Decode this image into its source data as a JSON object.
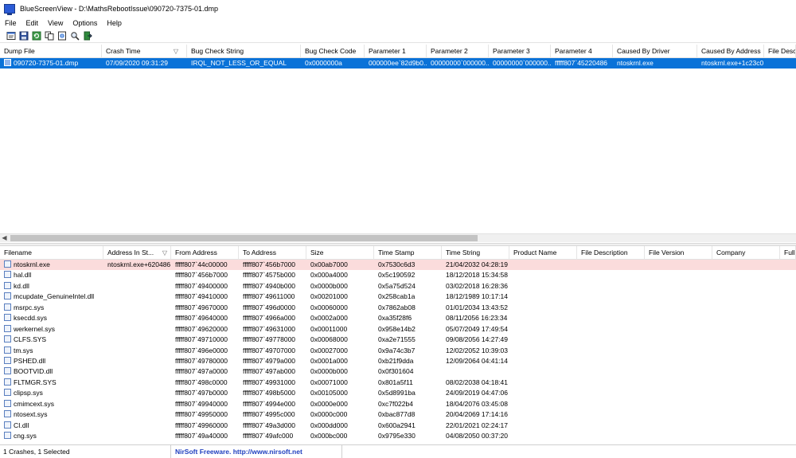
{
  "window": {
    "app_name": "BlueScreenView",
    "title": "BlueScreenView  -  D:\\MathsRebootIssue\\090720-7375-01.dmp"
  },
  "menu": [
    "File",
    "Edit",
    "View",
    "Options",
    "Help"
  ],
  "toolbar": {
    "buttons": [
      "properties-icon",
      "save-icon",
      "refresh-icon",
      "copy-icon",
      "html-report-icon",
      "find-icon",
      "exit-icon"
    ]
  },
  "crash_table": {
    "columns": [
      "Dump File",
      "Crash Time",
      "Bug Check String",
      "Bug Check Code",
      "Parameter 1",
      "Parameter 2",
      "Parameter 3",
      "Parameter 4",
      "Caused By Driver",
      "Caused By Address",
      "File Descr"
    ],
    "sort_indicator": "▽",
    "rows": [
      [
        "090720-7375-01.dmp",
        "07/09/2020 09:31:29",
        "IRQL_NOT_LESS_OR_EQUAL",
        "0x0000000a",
        "000000ee`82d9b0...",
        "00000000`000000...",
        "00000000`000000...",
        "fffff807`45220486",
        "ntoskrnl.exe",
        "ntoskrnl.exe+1c23c0",
        ""
      ]
    ]
  },
  "driver_table": {
    "columns": [
      "Filename",
      "Address In St...",
      "From Address",
      "To Address",
      "Size",
      "Time Stamp",
      "Time String",
      "Product Name",
      "File Description",
      "File Version",
      "Company",
      "Full"
    ],
    "sort_indicator": "▽",
    "rows": [
      [
        "ntoskrnl.exe",
        "ntoskrnl.exe+620486",
        "fffff807`44c00000",
        "fffff807`456b7000",
        "0x00ab7000",
        "0x7530c6d3",
        "21/04/2032 04:28:19",
        "",
        "",
        "",
        "",
        ""
      ],
      [
        "hal.dll",
        "",
        "fffff807`456b7000",
        "fffff807`4575b000",
        "0x000a4000",
        "0x5c190592",
        "18/12/2018 15:34:58",
        "",
        "",
        "",
        "",
        ""
      ],
      [
        "kd.dll",
        "",
        "fffff807`49400000",
        "fffff807`4940b000",
        "0x0000b000",
        "0x5a75d524",
        "03/02/2018 16:28:36",
        "",
        "",
        "",
        "",
        ""
      ],
      [
        "mcupdate_GenuineIntel.dll",
        "",
        "fffff807`49410000",
        "fffff807`49611000",
        "0x00201000",
        "0x258cab1a",
        "18/12/1989 10:17:14",
        "",
        "",
        "",
        "",
        ""
      ],
      [
        "msrpc.sys",
        "",
        "fffff807`49670000",
        "fffff807`496d0000",
        "0x00060000",
        "0x7862ab08",
        "01/01/2034 13:43:52",
        "",
        "",
        "",
        "",
        ""
      ],
      [
        "ksecdd.sys",
        "",
        "fffff807`49640000",
        "fffff807`4966a000",
        "0x0002a000",
        "0xa35f28f6",
        "08/11/2056 16:23:34",
        "",
        "",
        "",
        "",
        ""
      ],
      [
        "werkernel.sys",
        "",
        "fffff807`49620000",
        "fffff807`49631000",
        "0x00011000",
        "0x958e14b2",
        "05/07/2049 17:49:54",
        "",
        "",
        "",
        "",
        ""
      ],
      [
        "CLFS.SYS",
        "",
        "fffff807`49710000",
        "fffff807`49778000",
        "0x00068000",
        "0xa2e71555",
        "09/08/2056 14:27:49",
        "",
        "",
        "",
        "",
        ""
      ],
      [
        "tm.sys",
        "",
        "fffff807`496e0000",
        "fffff807`49707000",
        "0x00027000",
        "0x9a74c3b7",
        "12/02/2052 10:39:03",
        "",
        "",
        "",
        "",
        ""
      ],
      [
        "PSHED.dll",
        "",
        "fffff807`49780000",
        "fffff807`4979a000",
        "0x0001a000",
        "0xb21f9dda",
        "12/09/2064 04:41:14",
        "",
        "",
        "",
        "",
        ""
      ],
      [
        "BOOTVID.dll",
        "",
        "fffff807`497a0000",
        "fffff807`497ab000",
        "0x0000b000",
        "0x0f301604",
        "",
        "",
        "",
        "",
        "",
        ""
      ],
      [
        "FLTMGR.SYS",
        "",
        "fffff807`498c0000",
        "fffff807`49931000",
        "0x00071000",
        "0x801a5f11",
        "08/02/2038 04:18:41",
        "",
        "",
        "",
        "",
        ""
      ],
      [
        "clipsp.sys",
        "",
        "fffff807`497b0000",
        "fffff807`498b5000",
        "0x00105000",
        "0x5d8991ba",
        "24/09/2019 04:47:06",
        "",
        "",
        "",
        "",
        ""
      ],
      [
        "cmimcext.sys",
        "",
        "fffff807`49940000",
        "fffff807`4994e000",
        "0x0000e000",
        "0xc7f022b4",
        "18/04/2076 03:45:08",
        "",
        "",
        "",
        "",
        ""
      ],
      [
        "ntosext.sys",
        "",
        "fffff807`49950000",
        "fffff807`4995c000",
        "0x0000c000",
        "0xbac877d8",
        "20/04/2069 17:14:16",
        "",
        "",
        "",
        "",
        ""
      ],
      [
        "CI.dll",
        "",
        "fffff807`49960000",
        "fffff807`49a3d000",
        "0x000dd000",
        "0x600a2941",
        "22/01/2021 02:24:17",
        "",
        "",
        "",
        "",
        ""
      ],
      [
        "cng.sys",
        "",
        "fffff807`49a40000",
        "fffff807`49afc000",
        "0x000bc000",
        "0x9795e330",
        "04/08/2050 00:37:20",
        "",
        "",
        "",
        "",
        ""
      ]
    ]
  },
  "status": {
    "summary": "1 Crashes, 1 Selected",
    "credit": "NirSoft Freeware.  http://www.nirsoft.net"
  },
  "colors": {
    "selection": "#0a72d8",
    "highlight_row": "#fbdcdc",
    "credit_text": "#1f3fbf"
  }
}
